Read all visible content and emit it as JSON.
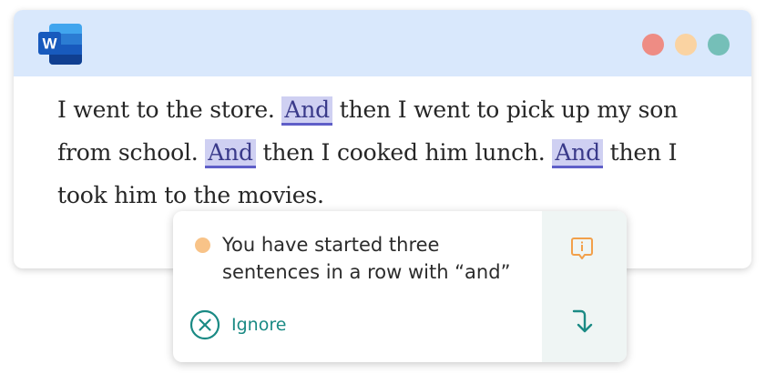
{
  "app": {
    "logo_letter": "W",
    "colors": {
      "titlebar": "#d9e8fc",
      "window_dot_red": "#ee8c84",
      "window_dot_yellow": "#fad3a2",
      "window_dot_green": "#75bfb8",
      "highlight": "#cfd0f2",
      "accent": "#1a8a84",
      "warning": "#f8c388"
    }
  },
  "document": {
    "lines": [
      [
        {
          "text": "I went to the store. ",
          "highlight": false
        },
        {
          "text": "And",
          "highlight": true
        },
        {
          "text": " then I went to pick up my son",
          "highlight": false
        }
      ],
      [
        {
          "text": "from school. ",
          "highlight": false
        },
        {
          "text": "And",
          "highlight": true
        },
        {
          "text": " then I cooked him lunch. ",
          "highlight": false
        },
        {
          "text": "And",
          "highlight": true
        },
        {
          "text": " then I",
          "highlight": false
        }
      ],
      [
        {
          "text": "took him to the movies.",
          "highlight": false
        }
      ]
    ]
  },
  "suggestion": {
    "message_lines": [
      "You have started three",
      "sentences in a row with “and”"
    ],
    "ignore_label": "Ignore",
    "icons": {
      "status": "warning-dot-icon",
      "ignore": "close-circle-icon",
      "info": "info-comment-icon",
      "apply": "arrow-down-turn-icon"
    }
  }
}
